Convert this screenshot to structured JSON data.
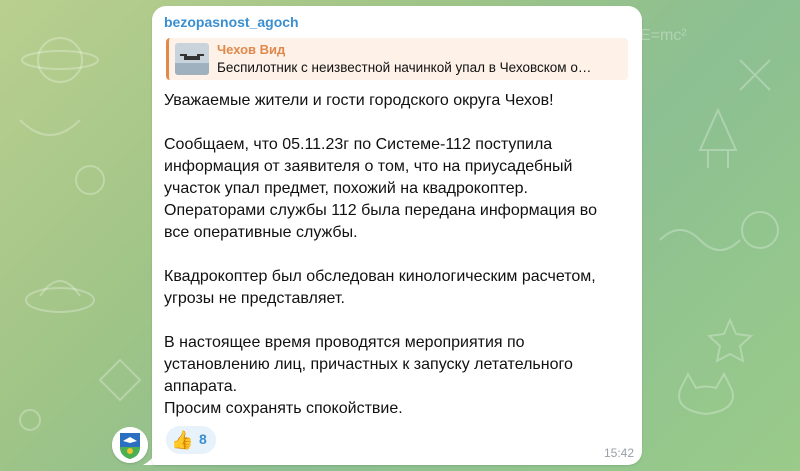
{
  "channel": {
    "name": "bezopasnost_agoch"
  },
  "reply": {
    "title": "Чехов Вид",
    "text": "Беспилотник с неизвестной начинкой упал в Чеховском о…"
  },
  "message": {
    "greeting": "Уважаемые жители и гости городского округа Чехов!",
    "p1_line1": "Сообщаем, что 05.11.23г по Системе-112 поступила",
    "p1_line2": "информация от заявителя о том, что на приусадебный",
    "p1_line3": "участок упал предмет, похожий на квадрокоптер.",
    "p1_line4": "Операторами службы 112 была передана информация во",
    "p1_line5": "все оперативные службы.",
    "p2_line1": "Квадрокоптер был обследован кинологическим расчетом,",
    "p2_line2": "угрозы не представляет.",
    "p3_line1": "В настоящее время проводятся мероприятия по",
    "p3_line2": "установлению лиц, причастных к запуску летательного",
    "p3_line3": "аппарата.",
    "p3_line4": "Просим сохранять спокойствие."
  },
  "reaction": {
    "icon": "thumbs-up-icon",
    "emoji": "👍",
    "count": "8"
  },
  "time": "15:42",
  "colors": {
    "sender": "#3a8fd0",
    "reply_accent": "#e0894b",
    "reaction_bg": "#e8f2fb"
  },
  "doodle_icons": [
    "planet-icon",
    "rocket-icon",
    "star-icon",
    "ufo-icon",
    "cat-icon",
    "formula-icon"
  ]
}
